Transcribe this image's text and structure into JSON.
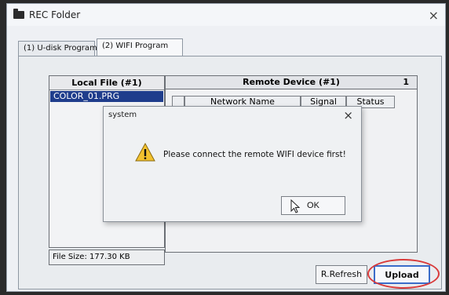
{
  "window": {
    "title": "REC Folder",
    "close_glyph": "×"
  },
  "tabs": [
    {
      "label": "(1) U-disk Program"
    },
    {
      "label": "(2) WIFI Program"
    }
  ],
  "local": {
    "header": "Local File (#1)",
    "items": [
      "COLOR_01.PRG"
    ],
    "file_size": "File Size:  177.30 KB"
  },
  "remote": {
    "header": "Remote Device (#1)",
    "count": "1",
    "columns": [
      "Network Name",
      "Signal",
      "Status"
    ]
  },
  "buttons": {
    "refresh": "R.Refresh",
    "upload": "Upload"
  },
  "dialog": {
    "title": "system",
    "close_glyph": "×",
    "message": "Please connect the remote WIFI device first!",
    "ok": "OK"
  },
  "colors": {
    "selection": "#1f3d8c",
    "annotation_ring": "#d93a3a",
    "default_button_border": "#3a6cc9"
  },
  "icons": {
    "window": "folder-icon",
    "dialog": "warning-icon"
  }
}
